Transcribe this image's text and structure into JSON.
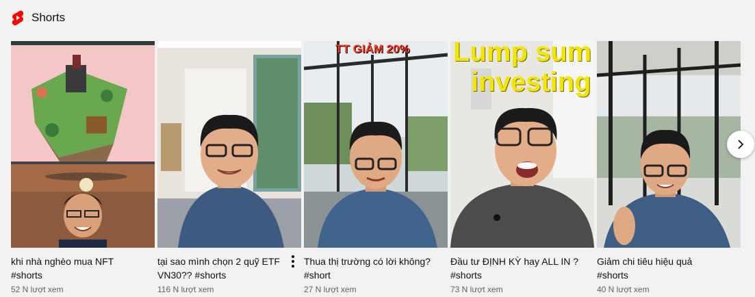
{
  "section": {
    "title": "Shorts",
    "icon": "youtube-shorts-icon",
    "accent": "#ff0000"
  },
  "shorts": [
    {
      "title_line1": "khi nhà nghèo mua NFT",
      "title_line2": "#shorts",
      "views": "52 N lượt xem",
      "overlay": ""
    },
    {
      "title_line1": "tại sao mình chọn 2 quỹ ETF",
      "title_line2": "VN30?? #shorts",
      "views": "116 N lượt xem",
      "overlay": ""
    },
    {
      "title_line1": "Thua thị trường có lời không?",
      "title_line2": "#short",
      "views": "27 N lượt xem",
      "overlay": "TT GIẢM 20%"
    },
    {
      "title_line1": "Đầu tư ĐỊNH KỲ hay ALL IN ?",
      "title_line2": "#shorts",
      "views": "73 N lượt xem",
      "overlay_line1": "Lump sum",
      "overlay_line2": "investing"
    },
    {
      "title_line1": "Giảm chi tiêu hiệu quả",
      "title_line2": "#shorts",
      "views": "40 N lượt xem",
      "overlay": ""
    }
  ],
  "controls": {
    "more_icon": "more-vert-icon",
    "next_icon": "chevron-right-icon"
  }
}
